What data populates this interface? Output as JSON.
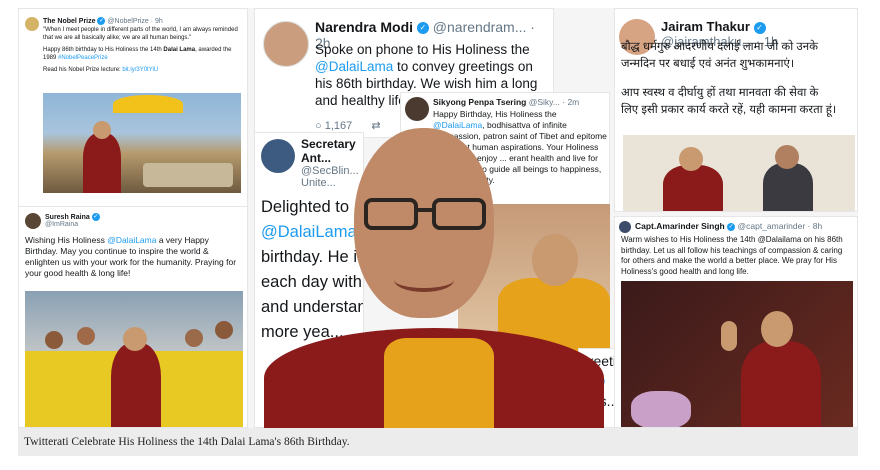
{
  "caption": "Twitterati Celebrate His Holiness the 14th Dalai Lama's 86th Birthday.",
  "tweets": {
    "nobel": {
      "name": "The Nobel Prize",
      "handle": "@NobelPrize · 9h",
      "text1": "\"When I meet people in different parts of the world, I am always reminded that we are all basically alike; we are all human beings.\"",
      "text2a": "Happy 86th birthday to His Holiness the 14th ",
      "text2b": "Dalai Lama",
      "text2c": ", awarded the 1989 ",
      "text2d": "#NobelPeacePrize",
      "text3a": "Read his Nobel Prize lecture: ",
      "text3b": "bit.ly/3Y0tYiU"
    },
    "raina": {
      "name": "Suresh Raina",
      "handle": "@ImRaina",
      "text_a": "Wishing His Holiness ",
      "text_b": "@DalaiLama",
      "text_c": " a very Happy Birthday. May you continue to inspire the world & enlighten us with your work for the humanity. Praying for your good health & long life!"
    },
    "modi": {
      "name": "Narendra Modi",
      "handle": "@narendram... · 2h",
      "text_a": "Spoke on phone to His Holiness the ",
      "text_b": "@DalaiLama",
      "text_c": " to convey greetings on his 86th birthday. We wish him a long and healthy life.",
      "reply_count": "1,167",
      "retweet_icon": "retweet-icon",
      "reply_icon": "reply-icon"
    },
    "penpa": {
      "name": "Sikyong Penpa Tsering",
      "handle": "@Siky... · 2m",
      "text_a": "Happy Birthday, His Holiness the ",
      "text_b": "@DalaiLama",
      "text_c": ", bodhisattva of infinite compassion, patron saint of Tibet and epitome of highest human aspirations. Your Holiness continue to enjoy ... erant health and live for eons and ... to guide all beings to happiness, ... m and dignity."
    },
    "blinken": {
      "name": "Secretary Ant...",
      "handle": "@SecBlin...",
      "location": "Unite...",
      "big_l1": "Delighted to",
      "big_l2": "@DalaiLama",
      "big_l3": "birthday. He i",
      "big_l4": "each day with i",
      "big_l5": "and understand",
      "big_l6": "more yea..."
    },
    "thakur": {
      "name": "Jairam Thakur",
      "handle": "@jairamthaku... · 1h",
      "text_l1": "बौद्ध धर्मगुरु आदरणीय दलाई लामा जी को उनके",
      "text_l2": "जन्मदिन पर बधाई एवं अनंत शुभकामनाएं।",
      "text_l3": "आप स्वस्थ व दीर्घायु हों तथा मानवता की सेवा के",
      "text_l4": "लिए इसी प्रकार कार्य करते रहें, यही कामना करता हूं।"
    },
    "amarinder": {
      "name": "Capt.Amarinder Singh",
      "handle": "@capt_amarinder · 8h",
      "text": "Warm wishes to His Holiness the 14th @Dalailama on his 86th birthday. Let us all follow his teachings of compassion & caring for others and make the world a better place. We pray for His Holiness's good health and long life."
    },
    "partial": {
      "greet": "greetin...",
      "mention": "@D",
      "cut": "bles..."
    }
  },
  "colors": {
    "twitter_blue": "#1d9bf0",
    "robe_maroon": "#8b1a1a",
    "saffron": "#e6a21a"
  }
}
